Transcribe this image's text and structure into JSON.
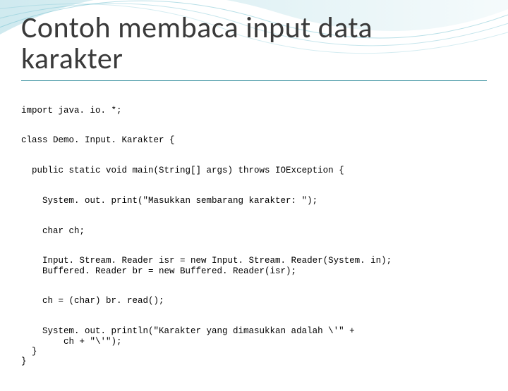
{
  "title_line1": "Contoh membaca input data",
  "title_line2": "karakter",
  "code": {
    "l1": "import java. io. *;",
    "l2": "class Demo. Input. Karakter {",
    "l3": "  public static void main(String[] args) throws IOException {",
    "l4": "    System. out. print(\"Masukkan sembarang karakter: \");",
    "l5": "    char ch;",
    "l6": "    Input. Stream. Reader isr = new Input. Stream. Reader(System. in);",
    "l7": "    Buffered. Reader br = new Buffered. Reader(isr);",
    "l8": "    ch = (char) br. read();",
    "l9": "    System. out. println(\"Karakter yang dimasukkan adalah \\'\" +",
    "l10": "        ch + \"\\'\");",
    "l11": "  }",
    "l12": "}"
  }
}
